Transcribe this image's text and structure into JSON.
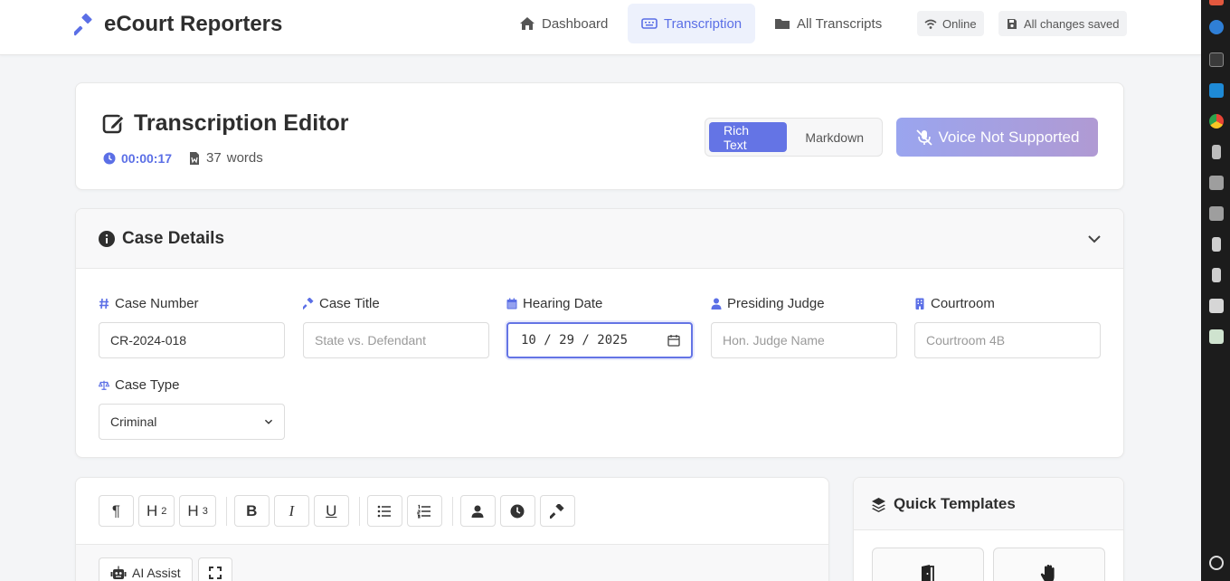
{
  "app": {
    "brand": "eCourt Reporters",
    "nav": [
      {
        "label": "Dashboard",
        "icon": "home-icon"
      },
      {
        "label": "Transcription",
        "icon": "keyboard-icon",
        "active": true
      },
      {
        "label": "All Transcripts",
        "icon": "folder-icon"
      }
    ],
    "status": {
      "online": "Online",
      "saved": "All changes saved"
    },
    "accent": "#5b6fe6"
  },
  "editor": {
    "title": "Transcription Editor",
    "timer": "00:00:17",
    "word_count": "37",
    "words_label": "words",
    "modes": [
      "Rich Text",
      "Markdown"
    ],
    "active_mode": "Rich Text",
    "voice_label": "Voice Not Supported"
  },
  "case_details": {
    "title": "Case Details",
    "fields": {
      "case_number": {
        "label": "Case Number",
        "value": "CR-2024-018"
      },
      "case_title": {
        "label": "Case Title",
        "placeholder": "State vs. Defendant"
      },
      "hearing_date": {
        "label": "Hearing Date",
        "value": "10 / 29 / 2025"
      },
      "presiding_judge": {
        "label": "Presiding Judge",
        "placeholder": "Hon. Judge Name"
      },
      "courtroom": {
        "label": "Courtroom",
        "placeholder": "Courtroom 4B"
      },
      "case_type": {
        "label": "Case Type",
        "value": "Criminal"
      }
    }
  },
  "toolbar": {
    "paragraph": "¶",
    "h2": {
      "main": "H",
      "sub": "2"
    },
    "h3": {
      "main": "H",
      "sub": "3"
    },
    "bold": "B",
    "italic": "I",
    "underline": "U",
    "ai_assist": "AI Assist"
  },
  "templates": {
    "title": "Quick Templates"
  }
}
